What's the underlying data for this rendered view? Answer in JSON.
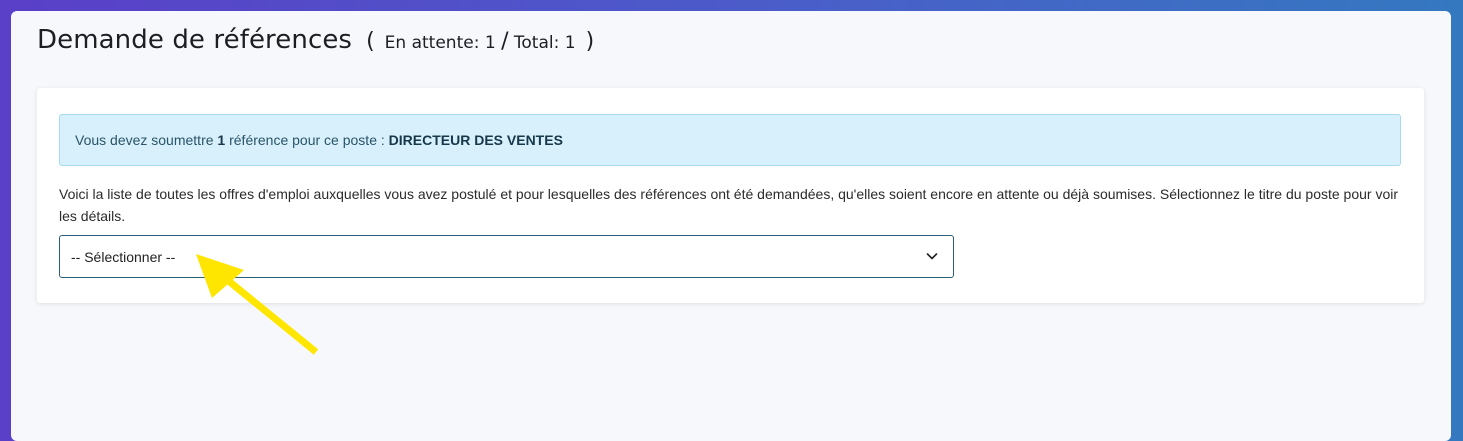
{
  "header": {
    "title": "Demande de références",
    "paren_open": "(",
    "pending_label": "En attente:",
    "pending_count": "1",
    "separator": "/",
    "total_label": "Total:",
    "total_count": "1",
    "paren_close": ")"
  },
  "info": {
    "prefix": "Vous devez soumettre",
    "count": "1",
    "middle": "référence pour ce poste :",
    "job_title": "DIRECTEUR DES VENTES"
  },
  "description": "Voici la liste de toutes les offres d'emploi auxquelles vous avez postulé et pour lesquelles des références ont été demandées, qu'elles soient encore en attente ou déjà soumises. Sélectionnez le titre du poste pour voir les détails.",
  "select": {
    "selected": "-- Sélectionner --"
  },
  "colors": {
    "info_bg": "#d7f0fb",
    "info_border": "#a6dcf0",
    "select_border": "#2b5e78",
    "annotation_arrow": "#ffe600"
  },
  "icons": {
    "dropdown": "chevron-down-icon",
    "annotation": "arrow-annotation-icon"
  }
}
